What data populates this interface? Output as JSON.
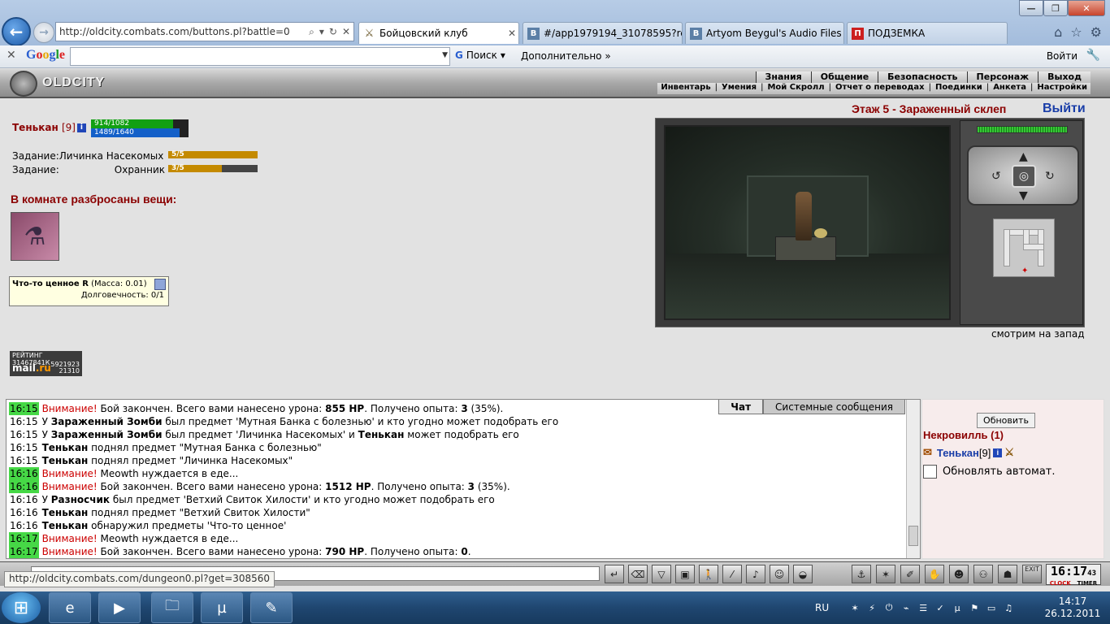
{
  "browser": {
    "address": "http://oldcity.combats.com/buttons.pl?battle=0",
    "tabs": [
      {
        "label": "Бойцовский клуб",
        "active": true
      },
      {
        "label": "#/app1979194_31078595?ref=1",
        "icon": "В"
      },
      {
        "label": "Artyom Beygul's Audio Files | ...",
        "icon": "В"
      },
      {
        "label": "ПОДЗЕМКА",
        "icon": "П"
      }
    ],
    "window_buttons": [
      "—",
      "❐",
      "✕"
    ]
  },
  "google_bar": {
    "logo": "Google",
    "search_button": "Поиск",
    "more": "Дополнительно »",
    "login": "Войти"
  },
  "game_header": {
    "logo_text": "OLDCITY",
    "top_menu": [
      "Знания",
      "Общение",
      "Безопасность",
      "Персонаж",
      "Выход"
    ],
    "sub_menu": [
      "Инвентарь",
      "Умения",
      "Мой Скролл",
      "Отчет о переводах",
      "Поединки",
      "Анкета",
      "Настройки"
    ]
  },
  "character": {
    "name": "Тенькан",
    "level": "[9]",
    "hp_text": "914/1082",
    "hp_fraction": 0.845,
    "mana_text": "1489/1640",
    "mana_fraction": 0.908
  },
  "tasks": [
    {
      "label": "Задание:",
      "name": "Личинка Насекомых",
      "progress": "5/5",
      "fraction": 1.0
    },
    {
      "label": "Задание:",
      "name": "Охранник",
      "progress": "3/5",
      "fraction": 0.6
    }
  ],
  "items_heading": "В комнате разбросаны вещи:",
  "item_tooltip": {
    "name": "Что-то ценное R",
    "mass": "(Масса: 0.01)",
    "durability": "Долговечность: 0/1"
  },
  "counter": {
    "title": "РЕЙТИНГ 31467841К",
    "brand_a": "mail",
    "brand_b": ".ru",
    "n1": "5921923",
    "n2": "21310"
  },
  "location": {
    "floor": "Этаж 5 - Зараженный склеп",
    "exit": "Выйти",
    "look": "смотрим на запад"
  },
  "chat": {
    "tabs": [
      "Чат",
      "Системные сообщения"
    ],
    "messages": [
      {
        "time": "16:15",
        "hl": true,
        "parts": [
          [
            "w",
            "Внимание!"
          ],
          [
            "t",
            " Бой закончен. Всего вами нанесено урона: "
          ],
          [
            "b",
            "855 HP"
          ],
          [
            "t",
            ". Получено опыта: "
          ],
          [
            "b",
            "3"
          ],
          [
            "t",
            " (35%)."
          ]
        ]
      },
      {
        "time": "16:15",
        "hl": false,
        "parts": [
          [
            "t",
            "У "
          ],
          [
            "b",
            "Зараженный Зомби"
          ],
          [
            "t",
            " был предмет 'Мутная Банка с болезнью' и кто угодно может подобрать его"
          ]
        ]
      },
      {
        "time": "16:15",
        "hl": false,
        "parts": [
          [
            "t",
            "У "
          ],
          [
            "b",
            "Зараженный Зомби"
          ],
          [
            "t",
            " был предмет 'Личинка Насекомых' и "
          ],
          [
            "b",
            "Тенькан"
          ],
          [
            "t",
            " может подобрать его"
          ]
        ]
      },
      {
        "time": "16:15",
        "hl": false,
        "parts": [
          [
            "b",
            "Тенькан"
          ],
          [
            "t",
            " поднял предмет \"Мутная Банка с болезнью\""
          ]
        ]
      },
      {
        "time": "16:15",
        "hl": false,
        "parts": [
          [
            "b",
            "Тенькан"
          ],
          [
            "t",
            " поднял предмет \"Личинка Насекомых\""
          ]
        ]
      },
      {
        "time": "16:16",
        "hl": true,
        "parts": [
          [
            "w",
            "Внимание!"
          ],
          [
            "t",
            " Meowth нуждается в еде..."
          ]
        ]
      },
      {
        "time": "16:16",
        "hl": true,
        "parts": [
          [
            "w",
            "Внимание!"
          ],
          [
            "t",
            " Бой закончен. Всего вами нанесено урона: "
          ],
          [
            "b",
            "1512 HP"
          ],
          [
            "t",
            ". Получено опыта: "
          ],
          [
            "b",
            "3"
          ],
          [
            "t",
            " (35%)."
          ]
        ]
      },
      {
        "time": "16:16",
        "hl": false,
        "parts": [
          [
            "t",
            "У "
          ],
          [
            "b",
            "Разносчик"
          ],
          [
            "t",
            " был предмет 'Ветхий Свиток Хилости' и кто угодно может подобрать его"
          ]
        ]
      },
      {
        "time": "16:16",
        "hl": false,
        "parts": [
          [
            "b",
            "Тенькан"
          ],
          [
            "t",
            " поднял предмет \"Ветхий Свиток Хилости\""
          ]
        ]
      },
      {
        "time": "16:16",
        "hl": false,
        "parts": [
          [
            "b",
            "Тенькан"
          ],
          [
            "t",
            " обнаружил предметы 'Что-то ценное'"
          ]
        ]
      },
      {
        "time": "16:17",
        "hl": true,
        "parts": [
          [
            "w",
            "Внимание!"
          ],
          [
            "t",
            " Meowth нуждается в еде..."
          ]
        ]
      },
      {
        "time": "16:17",
        "hl": true,
        "parts": [
          [
            "w",
            "Внимание!"
          ],
          [
            "t",
            " Бой закончен. Всего вами нанесено урона: "
          ],
          [
            "b",
            "790 HP"
          ],
          [
            "t",
            ". Получено опыта: "
          ],
          [
            "b",
            "0"
          ],
          [
            "t",
            "."
          ]
        ]
      }
    ]
  },
  "online": {
    "refresh": "Обновить",
    "location": "Некровилль (1)",
    "user_name": "Тенькан",
    "user_level": "[9]",
    "auto_update": "Обновлять автомат."
  },
  "clock": {
    "time": "16:17",
    "sec": "43",
    "label_a": "CLOCK",
    "label_b": "TIMER"
  },
  "status_url": "http://oldcity.combats.com/dungeon0.pl?get=308560",
  "taskbar": {
    "lang": "RU",
    "time": "14:17",
    "date": "26.12.2011"
  }
}
